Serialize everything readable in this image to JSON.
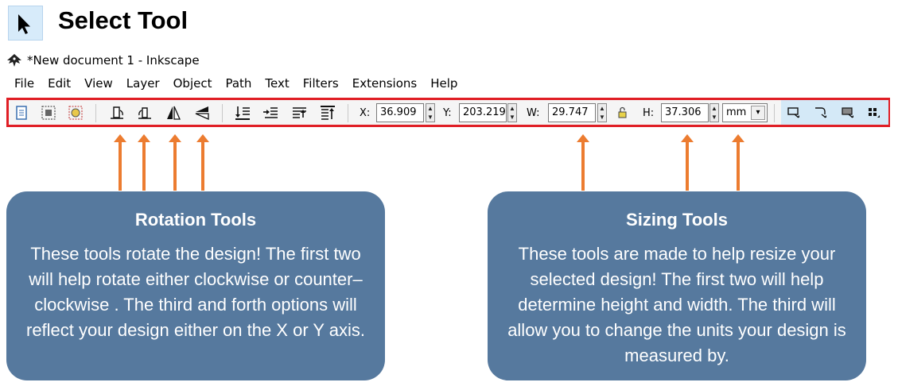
{
  "header": {
    "title": "Select Tool",
    "icon": "select-arrow-icon"
  },
  "window": {
    "title": "*New document 1 - Inkscape",
    "icon": "inkscape-logo-icon"
  },
  "menu": {
    "items": [
      {
        "label": "File"
      },
      {
        "label": "Edit"
      },
      {
        "label": "View"
      },
      {
        "label": "Layer"
      },
      {
        "label": "Object"
      },
      {
        "label": "Path"
      },
      {
        "label": "Text"
      },
      {
        "label": "Filters"
      },
      {
        "label": "Extensions"
      },
      {
        "label": "Help"
      }
    ]
  },
  "toolbar": {
    "x_label": "X:",
    "x_value": "36.909",
    "y_label": "Y:",
    "y_value": "203.219",
    "w_label": "W:",
    "w_value": "29.747",
    "h_label": "H:",
    "h_value": "37.306",
    "unit": "mm",
    "highlight_color": "#e01e25"
  },
  "callouts": {
    "rotation": {
      "title": "Rotation Tools",
      "body": "These tools rotate the design! The first two will help rotate either clockwise or counter– clockwise . The third and forth options will reflect your design either on the X or Y axis."
    },
    "sizing": {
      "title": "Sizing Tools",
      "body": "These tools are made to help resize your selected design! The first two will help determine height and width. The third will allow you to change the units your design is measured by."
    },
    "color": "#56799e",
    "arrow_color": "#ec7c30"
  }
}
